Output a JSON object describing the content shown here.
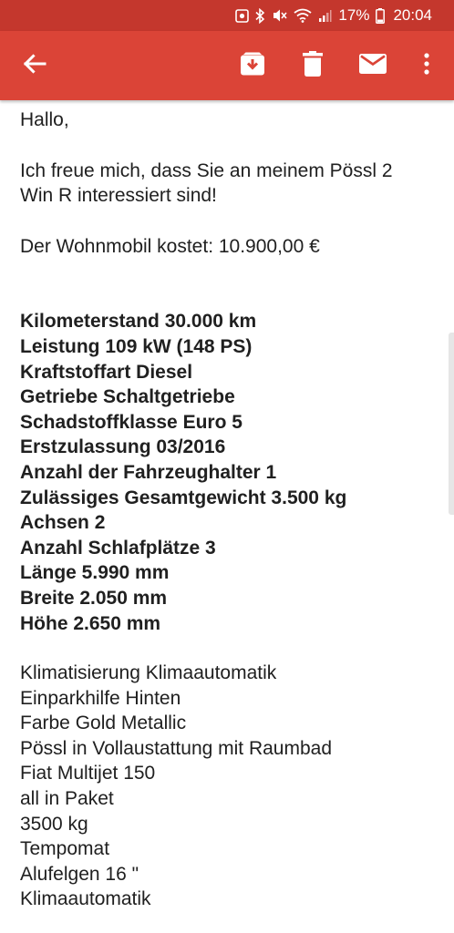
{
  "status_bar": {
    "battery_percent": "17%",
    "time": "20:04",
    "icons": [
      "notification-icon",
      "bluetooth-icon",
      "mute-icon",
      "wifi-icon",
      "signal-icon",
      "battery-icon"
    ]
  },
  "app_bar": {
    "background": "#db4437",
    "status_background": "#c4372d",
    "actions": [
      "back-arrow-icon",
      "archive-icon",
      "delete-icon",
      "mark-unread-icon",
      "more-vert-icon"
    ]
  },
  "email": {
    "greeting": "Hallo,",
    "intro_line1": "Ich freue mich, dass Sie an meinem Pössl 2",
    "intro_line2": "Win R interessiert sind!",
    "price_line": "Der Wohnmobil kostet: 10.900,00 €",
    "specs": [
      "Kilometerstand 30.000 km",
      "Leistung 109 kW (148 PS)",
      "Kraftstoffart Diesel",
      "Getriebe Schaltgetriebe",
      "Schadstoffklasse Euro 5",
      "Erstzulassung 03/2016",
      "Anzahl der Fahrzeughalter 1",
      "Zulässiges Gesamtgewicht 3.500 kg",
      "Achsen 2",
      "Anzahl Schlafplätze 3",
      "Länge 5.990 mm",
      "Breite 2.050 mm",
      "Höhe 2.650 mm"
    ],
    "features": [
      "Klimatisierung Klimaautomatik",
      "Einparkhilfe Hinten",
      "Farbe Gold Metallic",
      "Pössl in Vollaustattung mit Raumbad",
      "Fiat Multijet 150",
      "all in Paket",
      "3500 kg",
      "Tempomat",
      "Alufelgen 16 \"",
      "Klimaautomatik"
    ]
  }
}
